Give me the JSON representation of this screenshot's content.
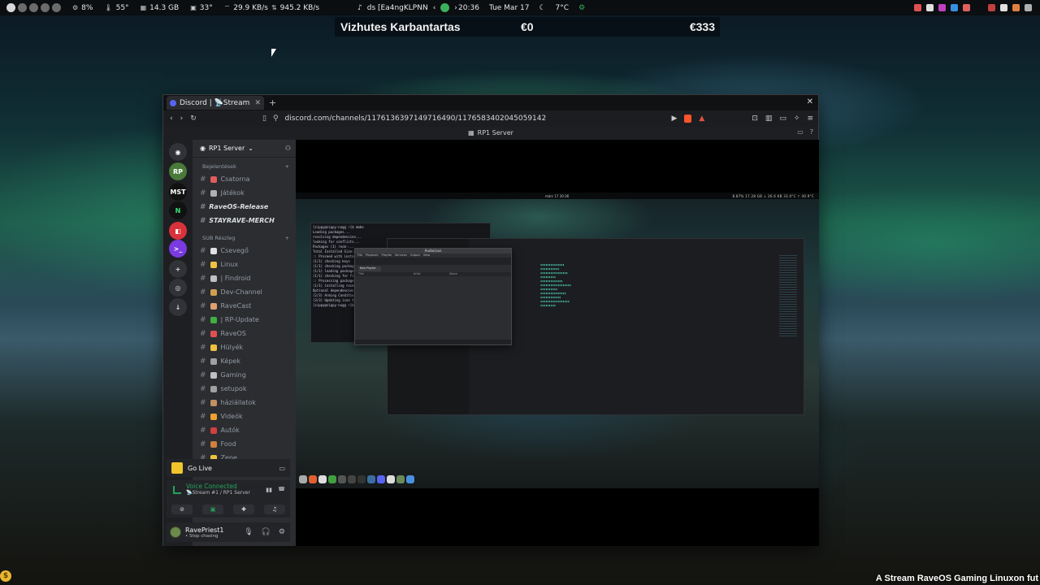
{
  "topbar": {
    "cpu": "8%",
    "temp1": "55°",
    "ram": "14.3 GB",
    "temp2": "33°",
    "net_down": "29.9 KB/s",
    "net_up": "945.2 KB/s",
    "media_title": "ds [Ea4ngKLPNN",
    "time": "20:36",
    "date": "Tue Mar 17",
    "weather": "7°C"
  },
  "ticker": {
    "label": "Vizhutes Karbantartas",
    "current": "€0",
    "goal": "€333"
  },
  "browser": {
    "tab_title": "Discord | 📡Stream",
    "url": "discord.com/channels/1176136397149716490/1176583402045059142",
    "page_title": "RP1 Server"
  },
  "discord": {
    "server_name": "RP1 Server",
    "categories": [
      {
        "label": "Bejelentések"
      },
      {
        "label": "SUB Részleg"
      }
    ],
    "channels_top": [
      {
        "label": "Csatorna",
        "color": "#e05d5d"
      },
      {
        "label": "Játékok",
        "color": "#b0b0b0"
      },
      {
        "label": "RaveOS-Release",
        "bold": true
      },
      {
        "label": "STAYRAVE-MERCH",
        "bold": true
      }
    ],
    "channels_sub": [
      {
        "label": "Csevegő",
        "color": "#e0e0e0"
      },
      {
        "label": "Linux",
        "color": "#f0c040"
      },
      {
        "label": "| Findroid",
        "color": "#c0c0c0"
      },
      {
        "label": "Dev-Channel",
        "color": "#d0a050"
      },
      {
        "label": "RaveCast",
        "color": "#e0a070"
      },
      {
        "label": "| RP-Update",
        "color": "#40b040"
      },
      {
        "label": "RaveOS",
        "color": "#e05050"
      },
      {
        "label": "Hülyék",
        "color": "#f0c040"
      },
      {
        "label": "Képek",
        "color": "#a0a0a0"
      },
      {
        "label": "Gaming",
        "color": "#c0c0c0"
      },
      {
        "label": "setupok",
        "color": "#a0a0a0"
      },
      {
        "label": "háziállatok",
        "color": "#c09060"
      },
      {
        "label": "Videók",
        "color": "#f0a030"
      },
      {
        "label": "Autók",
        "color": "#d04040"
      },
      {
        "label": "Food",
        "color": "#d08040"
      },
      {
        "label": "Zene",
        "color": "#f0c040"
      }
    ],
    "go_live": "Go Live",
    "voice_status": "Voice Connected",
    "voice_channel": "📡Stream #1 / RP1 Server",
    "username": "RavePriest1",
    "user_status": "• Stop chasing"
  },
  "stream": {
    "inner_clock": "márc 17  20:36",
    "inner_stats": "8.87%  17.28 GB  ↓ 26.6 KB  33.0°C  ↑ 40.9°C",
    "audio_title": "Audacious",
    "audio_menu": [
      "File",
      "Playback",
      "Playlist",
      "Services",
      "Output",
      "View"
    ],
    "audio_tab": "New Playlist",
    "audio_cols": [
      "Title",
      "Artist",
      "Album"
    ],
    "term_lines": [
      "[zippy@zippy-nugg ~]$ make",
      "Loading packages...",
      "resolving dependencies...",
      "looking for conflicts...",
      "Packages (1) rocm-...",
      "Total Installed Size: ...",
      ":: Proceed with installation?",
      "(1/1) checking keys",
      "(1/1) checking package integrity",
      "(1/1) loading package files",
      "(1/1) checking for file conflicts",
      ":: Processing package changes...",
      "(1/1) installing rocm",
      "Optional dependencies for rocm",
      "(2/3) Arming ConditionNeedsUpdate",
      "(3/3) Updating icon theme caches",
      "[zippy@zippy-nugg ~]$"
    ]
  },
  "bottom_ticker": "A Stream RaveOS Gaming Linuxon fut"
}
